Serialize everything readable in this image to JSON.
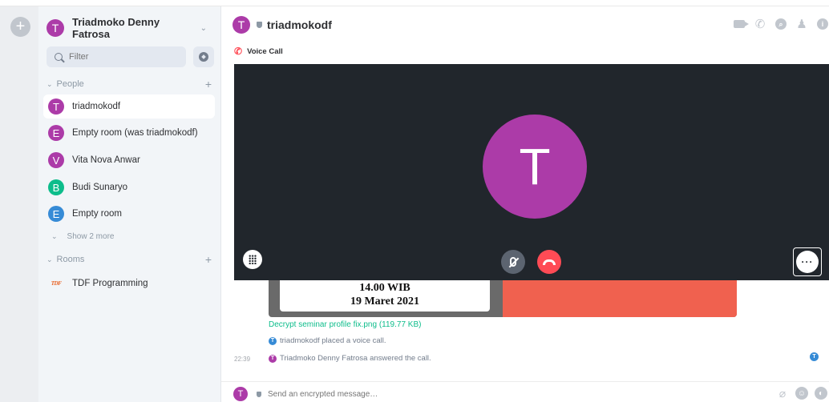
{
  "colors": {
    "accent_green": "#0dbd8b",
    "avatar_purple": "#ac3ba8",
    "avatar_green": "#0dbd8b",
    "avatar_blue": "#368bd6",
    "hangup_red": "#ff4b55",
    "call_bg": "#21262c"
  },
  "user": {
    "initial": "T",
    "name": "Triadmoko Denny Fatrosa"
  },
  "search": {
    "placeholder": "Filter"
  },
  "sidebar": {
    "people_label": "People",
    "people": [
      {
        "initial": "T",
        "name": "triadmokodf",
        "color": "#ac3ba8"
      },
      {
        "initial": "E",
        "name": "Empty room (was triadmokodf)",
        "color": "#ac3ba8"
      },
      {
        "initial": "V",
        "name": "Vita Nova Anwar",
        "color": "#ac3ba8"
      },
      {
        "initial": "B",
        "name": "Budi Sunaryo",
        "color": "#0dbd8b"
      },
      {
        "initial": "E",
        "name": "Empty room",
        "color": "#368bd6"
      }
    ],
    "show_more": "Show 2 more",
    "rooms_label": "Rooms",
    "rooms": [
      {
        "logo": "TDF",
        "name": "TDF Programming"
      }
    ]
  },
  "room": {
    "initial": "T",
    "title": "triadmokodf",
    "call_label": "Voice Call",
    "call_avatar_initial": "T"
  },
  "timeline": {
    "image_line1": "14.00 WIB",
    "image_line2": "19 Maret 2021",
    "file_link": "Decrypt seminar profile fix.png (119.77 KB)",
    "event1": "triadmokodf placed a voice call.",
    "event2_time": "22:39",
    "event2": "Triadmoko Denny Fatrosa answered the call."
  },
  "composer": {
    "placeholder": "Send an encrypted message…"
  }
}
